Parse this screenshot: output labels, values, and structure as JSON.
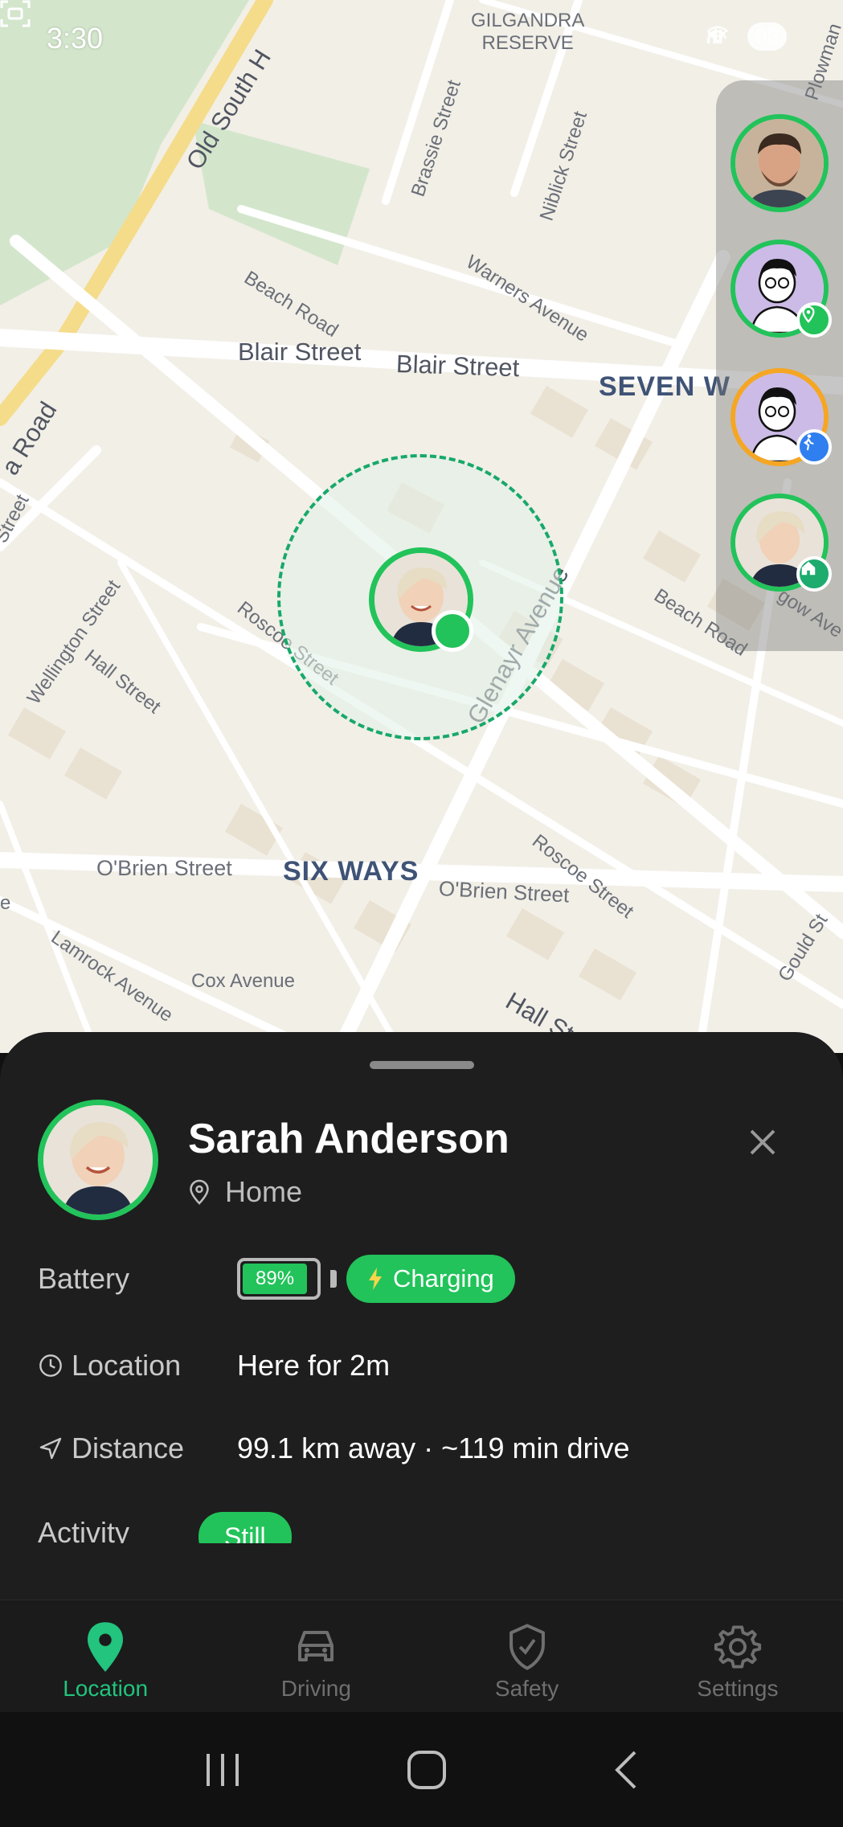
{
  "status_bar": {
    "time": "3:30",
    "battery": "98"
  },
  "map": {
    "reserve_label": "GILGANDRA\nRESERVE",
    "streets": {
      "old_south_head": "Old South H",
      "brassie": "Brassie Street",
      "niblick": "Niblick Street",
      "plowman": "Plowman",
      "beach_road_top": "Beach Road",
      "warners": "Warners Avenue",
      "blair1": "Blair Street",
      "blair2": "Blair Street",
      "road_left": "a Road",
      "street_left": "Street",
      "wellington": "Wellington Street",
      "hall": "Hall Street",
      "roscoe_center": "Roscoe Street",
      "glenayr": "Glenayr Avenue",
      "beach_road_right": "Beach Road",
      "glasgow": "gow Ave",
      "obrien_left": "O'Brien Street",
      "obrien_right": "O'Brien Street",
      "roscoe_right": "Roscoe Street",
      "lamrock": "Lamrock Avenue",
      "cox": "Cox Avenue",
      "hall_bottom": "Hall St",
      "gould": "Gould St",
      "e_left": "e"
    },
    "districts": {
      "seven_ways": "SEVEN W",
      "six_ways": "SIX WAYS"
    }
  },
  "members": [
    {
      "name": "member-1",
      "status": "none",
      "ring": "#22c35a"
    },
    {
      "name": "member-2",
      "status": "place",
      "ring": "#22c35a"
    },
    {
      "name": "member-3",
      "status": "walking",
      "ring": "#f5a623"
    },
    {
      "name": "member-4",
      "status": "home",
      "ring": "#22c35a"
    }
  ],
  "sheet": {
    "name": "Sarah Anderson",
    "place": "Home",
    "battery_label": "Battery",
    "battery_percent": "89%",
    "battery_level": 0.89,
    "charging_label": "Charging",
    "location_label": "Location",
    "location_value": "Here for 2m",
    "distance_label": "Distance",
    "distance_value": "99.1 km away · ~119 min drive",
    "activity_label": "Activity",
    "activity_value": "Still"
  },
  "nav": {
    "location": "Location",
    "driving": "Driving",
    "safety": "Safety",
    "settings": "Settings",
    "active_color": "#22c47e"
  },
  "colors": {
    "accent": "#22c35a",
    "walking": "#f5a623",
    "sheet_bg": "#1e1e1e"
  }
}
